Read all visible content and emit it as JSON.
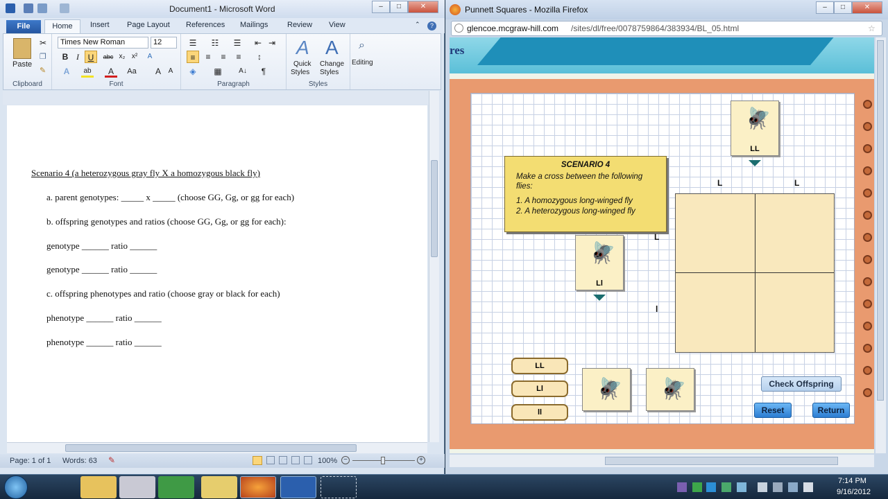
{
  "word": {
    "title": "Document1 - Microsoft Word",
    "tabs": [
      "Home",
      "Insert",
      "Page Layout",
      "References",
      "Mailings",
      "Review",
      "View"
    ],
    "file_tab": "File",
    "active_tab": "Home",
    "font_name": "Times New Roman",
    "font_size": "12",
    "groups": {
      "clipboard": "Clipboard",
      "font": "Font",
      "paragraph": "Paragraph",
      "styles": "Styles"
    },
    "buttons": {
      "paste": "Paste",
      "quick_styles_1": "Quick",
      "quick_styles_2": "Styles",
      "change_styles_1": "Change",
      "change_styles_2": "Styles",
      "editing": "Editing"
    },
    "document_lines": [
      "Scenario 4 (a heterozygous gray fly X a homozygous black fly)",
      "a. parent genotypes: _____ x _____ (choose GG, Gg, or gg for each)",
      "b. offspring genotypes and ratios (choose GG, Gg, or gg for each):",
      "genotype ______ ratio ______",
      "genotype ______ ratio ______",
      "c. offspring phenotypes and ratio (choose gray or black for each)",
      "phenotype ______ ratio ______",
      "phenotype ______ ratio ______"
    ],
    "status": {
      "page": "Page: 1 of 1",
      "words": "Words: 63",
      "zoom": "100%"
    }
  },
  "firefox": {
    "title": "Punnett Squares - Mozilla Firefox",
    "url_domain": "glencoe.mcgraw-hill.com",
    "url_path": "/sites/dl/free/0078759864/383934/BL_05.html",
    "banner_text": "res"
  },
  "lab": {
    "scenario_title": "SCENARIO 4",
    "scenario_text": "Make a cross between the following flies:",
    "items": [
      "1. A homozygous long-winged fly",
      "2. A heterozygous long-winged fly"
    ],
    "top_fly_label": "LL",
    "left_fly_label": "Ll",
    "top_alleles": [
      "L",
      "L"
    ],
    "left_alleles": [
      "L",
      "l"
    ],
    "choices": [
      "LL",
      "Ll",
      "ll"
    ],
    "check_button": "Check Offspring",
    "reset_button": "Reset",
    "return_button": "Return"
  },
  "taskbar": {
    "time": "7:14 PM",
    "date": "9/16/2012"
  }
}
